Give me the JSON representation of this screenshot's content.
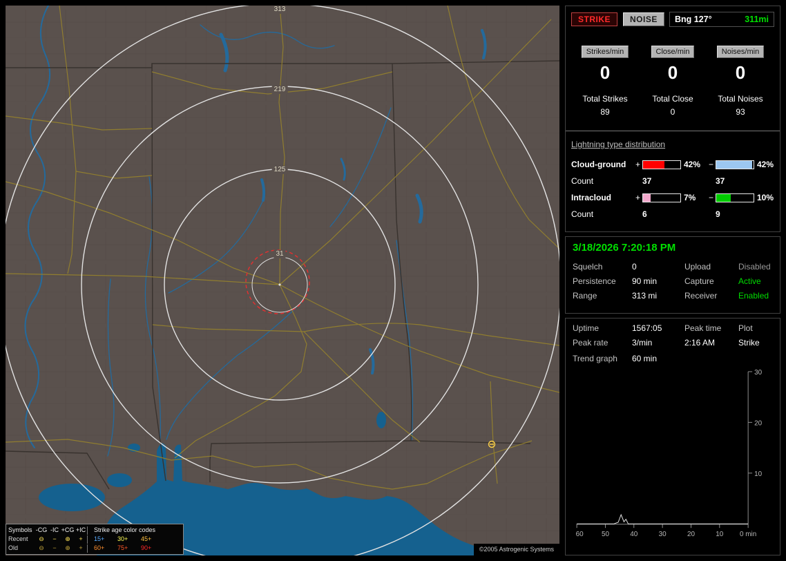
{
  "colors": {
    "accent_green": "#00dd00",
    "strike_red": "#ff2a2a",
    "noise_gray": "#b4b4b4",
    "bar_cg_plus": "#ff0000",
    "bar_cg_minus": "#9cc7f0",
    "bar_ic_plus": "#f2a8cc",
    "bar_ic_minus": "#00cc00",
    "disabled_gray": "#9a9a9a",
    "map_land": "#5a514d",
    "map_water": "#15618f",
    "map_road": "#93802e",
    "range_ring": "#e2e2e2",
    "storm_circle_red": "#e03030"
  },
  "map": {
    "ring_labels": [
      "313",
      "219",
      "125",
      "31"
    ],
    "copyright": "©2005 Astrogenic Systems",
    "legend": {
      "symbols_title": "Symbols",
      "columns": [
        "-CG",
        "-IC",
        "+CG",
        "+IC"
      ],
      "symbol_glyphs": [
        "⊖",
        "−",
        "⊕",
        "+"
      ],
      "age_title": "Strike age color codes",
      "recent_label": "Recent",
      "old_label": "Old",
      "recent_ages": [
        "15+",
        "30+",
        "45+"
      ],
      "old_ages": [
        "60+",
        "75+",
        "90+"
      ],
      "age_colors": [
        "#58aaff",
        "#ffff58",
        "#ffc040",
        "#ff9030",
        "#ff5828",
        "#ff2828"
      ]
    }
  },
  "panel": {
    "header": {
      "strike": "STRIKE",
      "noise": "NOISE",
      "bearing": "Bng 127°",
      "distance": "311mi"
    },
    "rates": {
      "labels": [
        "Strikes/min",
        "Close/min",
        "Noises/min"
      ],
      "values": [
        "0",
        "0",
        "0"
      ]
    },
    "totals": {
      "labels": [
        "Total Strikes",
        "Total Close",
        "Total Noises"
      ],
      "values": [
        "89",
        "0",
        "93"
      ]
    },
    "distribution": {
      "title": "Lightning type distribution",
      "count_label": "Count",
      "plus_sign": "+",
      "minus_sign": "−",
      "cloud_ground": {
        "name": "Cloud-ground",
        "plus_pct": "42%",
        "minus_pct": "42%",
        "plus_count": "37",
        "minus_count": "37",
        "plus_fill": 58,
        "minus_fill": 96
      },
      "intracloud": {
        "name": "Intracloud",
        "plus_pct": "7%",
        "minus_pct": "10%",
        "plus_count": "6",
        "minus_count": "9",
        "plus_fill": 20,
        "minus_fill": 38
      }
    },
    "datetime": "3/18/2026 7:20:18 PM",
    "status": {
      "squelch_label": "Squelch",
      "squelch_value": "0",
      "persistence_label": "Persistence",
      "persistence_value": "90 min",
      "range_label": "Range",
      "range_value": "313 mi",
      "upload_label": "Upload",
      "upload_value": "Disabled",
      "capture_label": "Capture",
      "capture_value": "Active",
      "receiver_label": "Receiver",
      "receiver_value": "Enabled"
    },
    "info": {
      "uptime_label": "Uptime",
      "uptime_value": "1567:05",
      "peak_time_label": "Peak time",
      "peak_time_value": "2:16 AM",
      "plot_label": "Plot",
      "plot_value": "Strike",
      "peak_rate_label": "Peak rate",
      "peak_rate_value": "3/min",
      "trend_label": "Trend graph",
      "trend_value": "60 min"
    }
  },
  "chart_data": {
    "type": "line",
    "title": "Trend graph (strikes per minute, last 60 min)",
    "xlabel": "min",
    "ylabel": "",
    "ylim": [
      0,
      30
    ],
    "x_minutes_ago_range": [
      60,
      0
    ],
    "x_ticks": [
      "60",
      "50",
      "40",
      "30",
      "20",
      "10",
      "0 min"
    ],
    "y_ticks": [
      "30",
      "20",
      "10"
    ],
    "grid": false,
    "legend_position": "none",
    "series": [
      {
        "name": "Strike",
        "points_minutes_ago_value": [
          [
            60,
            0
          ],
          [
            47,
            0
          ],
          [
            45.5,
            0.3
          ],
          [
            44.5,
            1.8
          ],
          [
            43.5,
            0.4
          ],
          [
            42.8,
            0.9
          ],
          [
            42,
            0
          ],
          [
            0,
            0
          ]
        ]
      }
    ]
  }
}
